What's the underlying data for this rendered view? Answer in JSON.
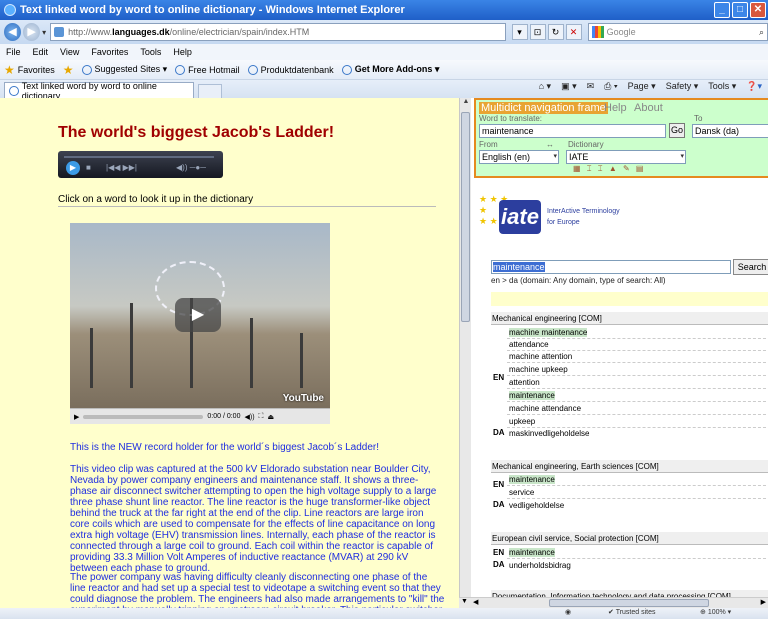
{
  "window": {
    "title": "Text linked word by word to online dictionary - Windows Internet Explorer"
  },
  "address": {
    "prefix": "http://www.",
    "domain": "languages.dk",
    "path": "/online/electrician/spain/index.HTM"
  },
  "search": {
    "placeholder": "Google"
  },
  "menu": [
    "File",
    "Edit",
    "View",
    "Favorites",
    "Tools",
    "Help"
  ],
  "favorites": {
    "label": "Favorites",
    "items": [
      "Suggested Sites ▾",
      "Free Hotmail",
      "Produktdatenbank",
      "Get More Add-ons ▾"
    ]
  },
  "tab": {
    "label": "Text linked word by word to online dictionary"
  },
  "cmdbar": [
    "Page ▾",
    "Safety ▾",
    "Tools ▾"
  ],
  "left": {
    "heading": "The world's biggest Jacob's Ladder!",
    "instruction": "Click on a word to look it up in the dictionary",
    "video": {
      "time": "0:00 / 0:00",
      "logo": "YouTube"
    },
    "paragraphs": [
      "This is the NEW record holder for the world´s biggest Jacob´s Ladder!",
      "This video clip was captured at the 500 kV Eldorado substation near Boulder City, Nevada by power company engineers and maintenance staff. It shows a three-phase air disconnect switcher attempting to open the high voltage supply to a large three phase shunt line reactor. The line reactor is the huge transformer-like object behind the truck at the far right at the end of the clip. Line reactors are large iron core coils which are used to compensate for the effects of line capacitance on long extra high voltage (EHV) transmission lines. Internally, each phase of the reactor is connected through a large coil to ground. Each coil within the reactor is capable of providing 33.3 Million Volt Amperes of inductive reactance (MVAR) at 290 kV between each phase to ground.",
      "The power company was having difficulty cleanly disconnecting one phase of the line reactor and had set up a special test to videotape a switching event so that they could diagnose the problem. The engineers had also made arrangements to \"kill\" the experiment by manually tripping an upstream circuit breaker. This particular switcher"
    ]
  },
  "multidict": {
    "title": "Multidict navigation frame",
    "help": "Help",
    "about": "About",
    "word_label": "Word to translate:",
    "word_value": "maintenance",
    "go": "Go",
    "to_label": "To",
    "to_value": "Dansk (da)",
    "from_label": "From",
    "swap": "↔",
    "dict_label": "Dictionary",
    "from_value": "English (en)",
    "dict_value": "IATE"
  },
  "iate": {
    "logo": "iate",
    "tagline_1": "InterActive Terminology",
    "tagline_2": "for Europe",
    "query": "maintenance",
    "search_btn": "Search",
    "domain_line": "en > da (domain: Any domain, type of search: All)",
    "sections": [
      {
        "head": "Mechanical engineering [COM]",
        "en": [
          "machine maintenance",
          "attendance",
          "machine attention",
          "machine upkeep",
          "attention",
          "maintenance",
          "machine attendance",
          "upkeep"
        ],
        "da": [
          "maskinvedligeholdelse"
        ]
      },
      {
        "head": "Mechanical engineering, Earth sciences [COM]",
        "en": [
          "maintenance",
          "service"
        ],
        "da": [
          "vedligeholdelse"
        ]
      },
      {
        "head": "European civil service, Social protection [COM]",
        "en": [
          "maintenance"
        ],
        "da": [
          "underholdsbidrag"
        ]
      },
      {
        "head": "Documentation, Information technology and data processing [COM]",
        "en": [],
        "da": []
      }
    ],
    "lang_en": "EN",
    "lang_da": "DA"
  },
  "status": {
    "zone": "Trusted sites",
    "zoom": "100%"
  }
}
